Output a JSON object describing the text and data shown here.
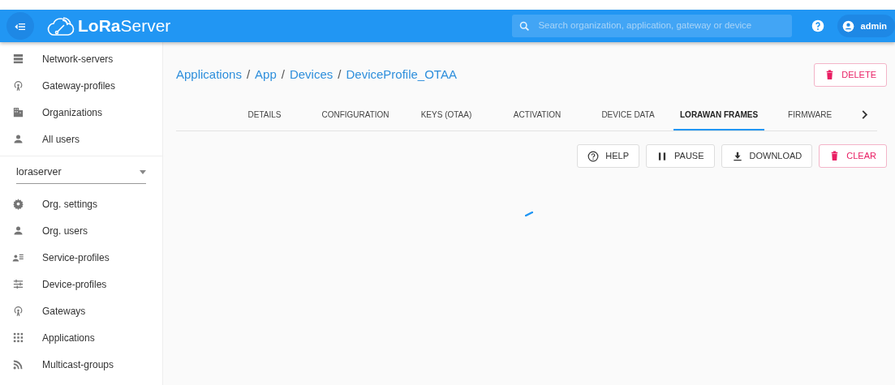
{
  "header": {
    "logo_bold": "LoRa",
    "logo_light": "Server",
    "search": {
      "placeholder": "Search organization, application, gateway or device"
    },
    "user": "admin"
  },
  "sidebar": {
    "items": [
      {
        "label": "Network-servers"
      },
      {
        "label": "Gateway-profiles"
      },
      {
        "label": "Organizations"
      },
      {
        "label": "All users"
      }
    ],
    "organization": "loraserver",
    "org_items": [
      {
        "label": "Org. settings"
      },
      {
        "label": "Org. users"
      },
      {
        "label": "Service-profiles"
      },
      {
        "label": "Device-profiles"
      },
      {
        "label": "Gateways"
      },
      {
        "label": "Applications"
      },
      {
        "label": "Multicast-groups"
      }
    ]
  },
  "breadcrumb": [
    {
      "label": "Applications",
      "kind": "link"
    },
    {
      "label": "/",
      "kind": "separator"
    },
    {
      "label": "App",
      "kind": "link"
    },
    {
      "label": "/",
      "kind": "separator"
    },
    {
      "label": "Devices",
      "kind": "link"
    },
    {
      "label": "/",
      "kind": "separator"
    },
    {
      "label": "DeviceProfile_OTAA",
      "kind": "link"
    }
  ],
  "delete_button": "DELETE",
  "tabs": [
    {
      "label": "DETAILS",
      "selected": false
    },
    {
      "label": "CONFIGURATION",
      "selected": false
    },
    {
      "label": "KEYS (OTAA)",
      "selected": false
    },
    {
      "label": "ACTIVATION",
      "selected": false
    },
    {
      "label": "DEVICE DATA",
      "selected": false
    },
    {
      "label": "LORAWAN FRAMES",
      "selected": true
    },
    {
      "label": "FIRMWARE",
      "selected": false
    }
  ],
  "actions": [
    {
      "label": "HELP",
      "kind": "help"
    },
    {
      "label": "PAUSE",
      "kind": "pause"
    },
    {
      "label": "DOWNLOAD",
      "kind": "download"
    },
    {
      "label": "CLEAR",
      "kind": "clear"
    }
  ]
}
